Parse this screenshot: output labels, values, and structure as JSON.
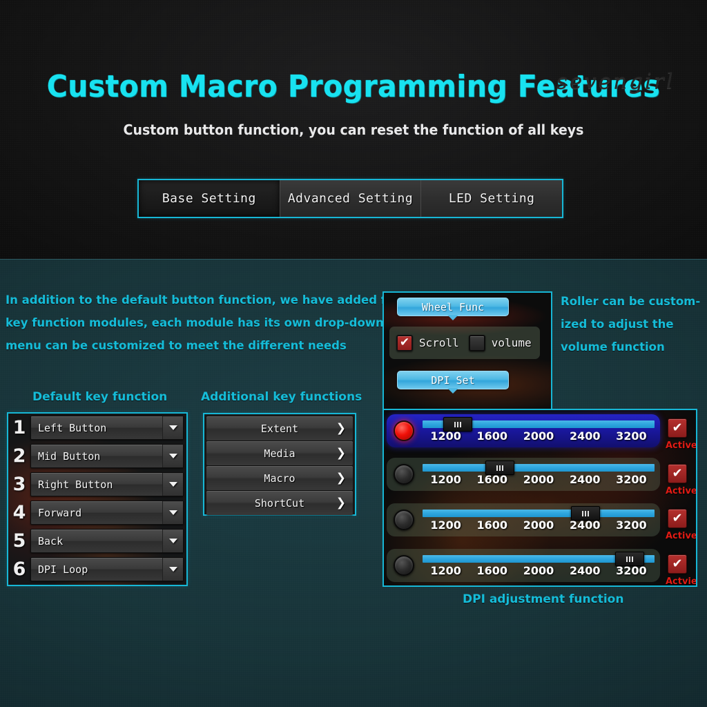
{
  "hero": {
    "title": "Custom Macro Programming Features",
    "watermark": "sevengirl",
    "subtitle": "Custom button function, you can reset the function of all keys",
    "tabs": [
      {
        "label": "Base Setting",
        "active": true
      },
      {
        "label": "Advanced Setting",
        "active": false
      },
      {
        "label": "LED Setting",
        "active": false
      }
    ]
  },
  "lower": {
    "intro_lines": [
      "In addition to the default button function, we have added  four",
      "key function modules, each module has its own drop-down",
      "menu can be customized to meet the different needs"
    ],
    "side_note_lines": [
      "Roller can be custom-",
      "ized to adjust the",
      "volume function"
    ],
    "default_heading": "Default key function",
    "additional_heading": "Additional key functions",
    "dpi_caption": "DPI adjustment function"
  },
  "default_keys": [
    {
      "num": "1",
      "label": "Left Button"
    },
    {
      "num": "2",
      "label": "Mid Button"
    },
    {
      "num": "3",
      "label": "Right Button"
    },
    {
      "num": "4",
      "label": "Forward"
    },
    {
      "num": "5",
      "label": "Back"
    },
    {
      "num": "6",
      "label": "DPI Loop"
    }
  ],
  "additional_keys": [
    {
      "label": "Extent",
      "chevron": "❯"
    },
    {
      "label": "Media",
      "chevron": "❯"
    },
    {
      "label": "Macro",
      "chevron": "❯"
    },
    {
      "label": "ShortCut",
      "chevron": "❯"
    }
  ],
  "wheel_panel": {
    "header": "Wheel Func",
    "dpi_header": "DPI Set",
    "options": [
      {
        "label": "Scroll",
        "checked": true,
        "mark": "✔"
      },
      {
        "label": "volume",
        "checked": false,
        "mark": ""
      }
    ]
  },
  "dpi_panel": {
    "tick_labels": [
      "1200",
      "1600",
      "2000",
      "2400",
      "3200"
    ],
    "rows": [
      {
        "led": "on",
        "selected": true,
        "value": "1200",
        "thumb_percent": 9,
        "active_label": "Active",
        "active_mark": "✔"
      },
      {
        "led": "off",
        "selected": false,
        "value": "1600",
        "thumb_percent": 27,
        "active_label": "Active",
        "active_mark": "✔"
      },
      {
        "led": "off",
        "selected": false,
        "value": "2400",
        "thumb_percent": 64,
        "active_label": "Active",
        "active_mark": "✔"
      },
      {
        "led": "off",
        "selected": false,
        "value": "3200",
        "thumb_percent": 83,
        "active_label": "Actvie",
        "active_mark": "✔"
      }
    ]
  },
  "colors": {
    "accent_cyan": "#17b7d6",
    "title_cyan": "#18e2f0",
    "text_cyan": "#15bcd8",
    "slider_blue": "#2ea6de",
    "active_red": "#b5302e",
    "led_red": "#f01008",
    "hero_bg": "#141414",
    "lower_bg": "#173338"
  }
}
